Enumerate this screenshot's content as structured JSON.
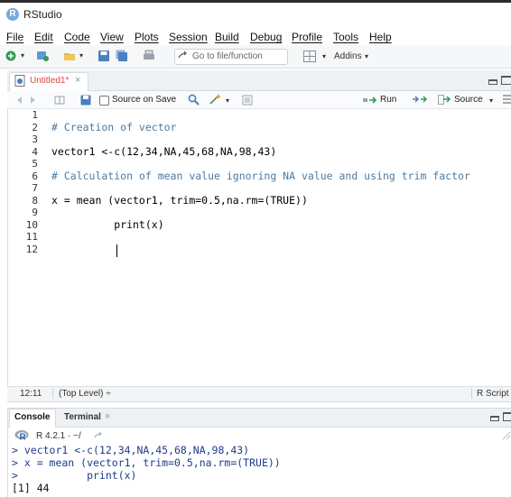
{
  "app": {
    "title": "RStudio",
    "icon": "R"
  },
  "menu": [
    "File",
    "Edit",
    "Code",
    "View",
    "Plots",
    "Session",
    "Build",
    "Debug",
    "Profile",
    "Tools",
    "Help"
  ],
  "toolbar": {
    "goto_placeholder": "Go to file/function",
    "addins_label": "Addins"
  },
  "editor": {
    "tab_label": "Untitled1*",
    "tab_close": "×",
    "source_on_save_label": "Source on Save",
    "run_label": "Run",
    "source_label": "Source",
    "lines": [
      {
        "num": "1",
        "text": ""
      },
      {
        "num": "2",
        "text": "# Creation of vector"
      },
      {
        "num": "3",
        "text": ""
      },
      {
        "num": "4",
        "text": "vector1 <-c(12,34,NA,45,68,NA,98,43)"
      },
      {
        "num": "5",
        "text": ""
      },
      {
        "num": "6",
        "text": "# Calculation of mean value ignoring NA value and using trim factor"
      },
      {
        "num": "7",
        "text": ""
      },
      {
        "num": "8",
        "text": "x = mean (vector1, trim=0.5,na.rm=(TRUE))"
      },
      {
        "num": "9",
        "text": ""
      },
      {
        "num": "10",
        "text": "          print(x)"
      },
      {
        "num": "11",
        "text": ""
      },
      {
        "num": "12",
        "text": ""
      }
    ],
    "status_position": "12:11",
    "status_scope": "(Top Level) ÷",
    "status_type": "R Script"
  },
  "console": {
    "tab_console": "Console",
    "tab_terminal": "Terminal",
    "terminal_close": "×",
    "r_version": "R 4.2.1 · ~/",
    "lines": [
      "> vector1 <-c(12,34,NA,45,68,NA,98,43)",
      "> x = mean (vector1, trim=0.5,na.rm=(TRUE))",
      ">           print(x)",
      "[1] 44"
    ]
  },
  "colors": {
    "accent": "#75aadb",
    "comment": "#4d7aa0",
    "keyword": "#6b55b5",
    "prompt": "#1f3b8a",
    "tab_modified": "#dd4444"
  }
}
